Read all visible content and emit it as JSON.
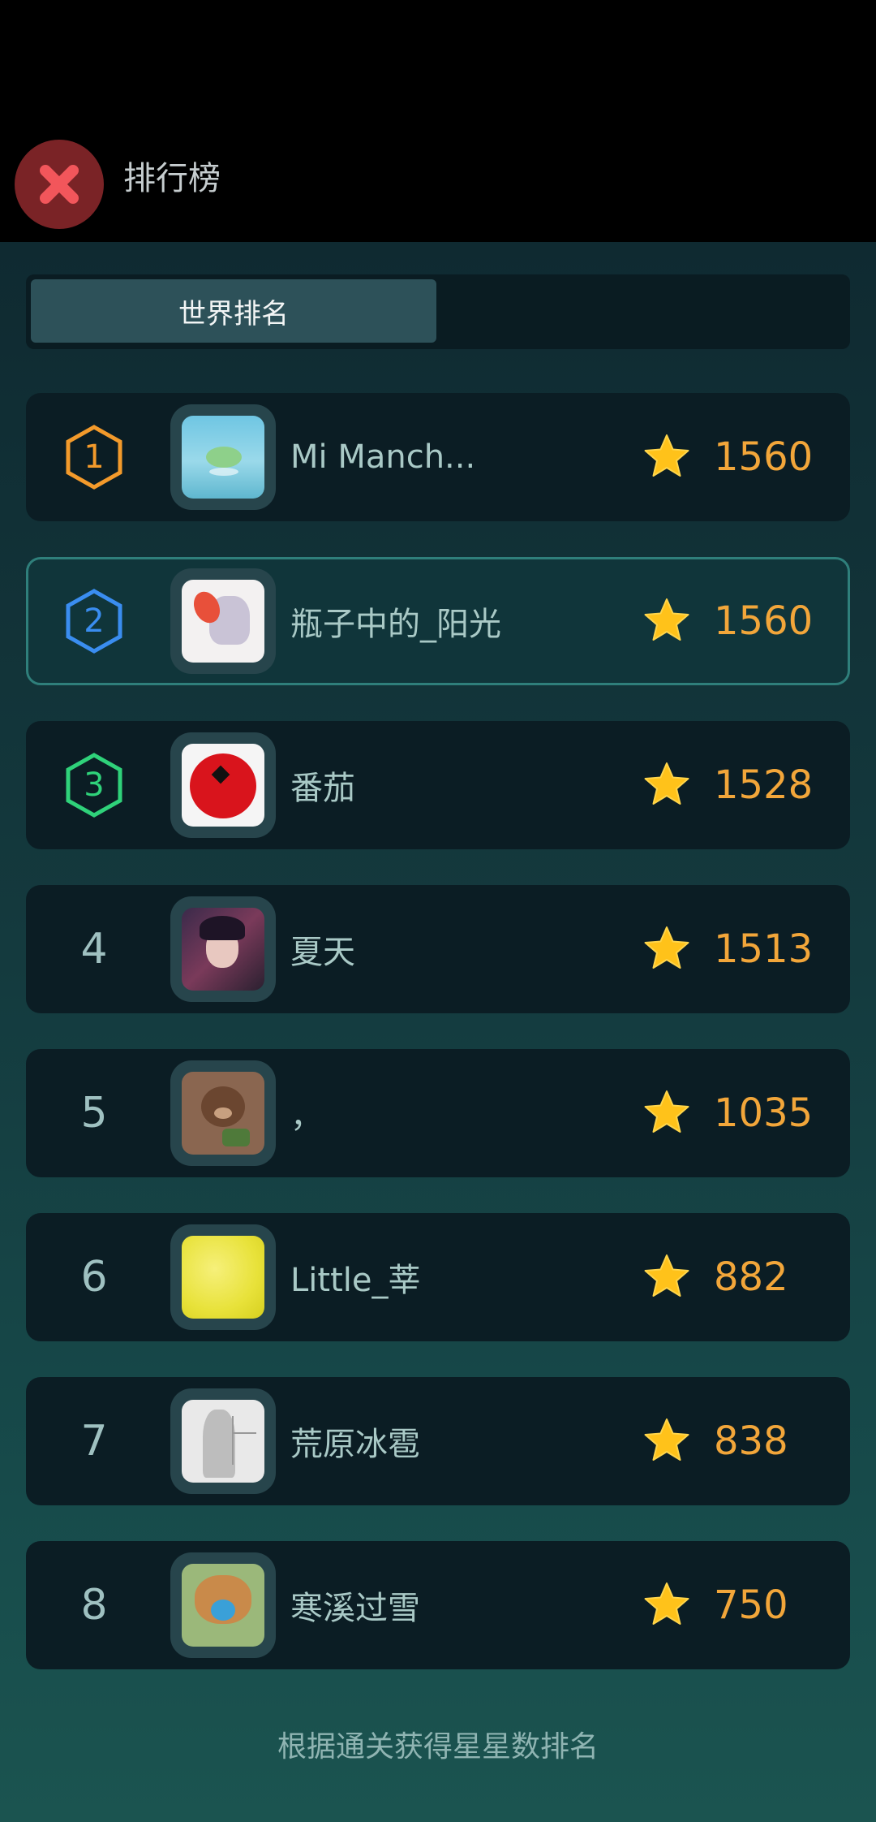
{
  "header": {
    "title": "排行榜"
  },
  "tabs": [
    {
      "label": "世界排名",
      "active": true
    }
  ],
  "leaderboard": [
    {
      "rank": "1",
      "name": "Mi Manch...",
      "score": "1560",
      "badge_color": "#f39a2b"
    },
    {
      "rank": "2",
      "name": "瓶子中的_阳光",
      "score": "1560",
      "badge_color": "#3a8df0"
    },
    {
      "rank": "3",
      "name": "番茄",
      "score": "1528",
      "badge_color": "#2fd27a"
    },
    {
      "rank": "4",
      "name": "夏天",
      "score": "1513"
    },
    {
      "rank": "5",
      "name": "，",
      "score": "1035"
    },
    {
      "rank": "6",
      "name": "Little_莘",
      "score": "882"
    },
    {
      "rank": "7",
      "name": "荒原冰雹",
      "score": "838"
    },
    {
      "rank": "8",
      "name": "寒溪过雪",
      "score": "750"
    }
  ],
  "footer": {
    "note": "根据通关获得星星数排名"
  },
  "icons": {
    "close": "close-icon",
    "star": "star-icon",
    "rank_badge": "hexagon-badge-icon"
  },
  "colors": {
    "score": "#f2a63a",
    "star": "#ffc21a",
    "highlight_border": "#2f7f7b"
  }
}
